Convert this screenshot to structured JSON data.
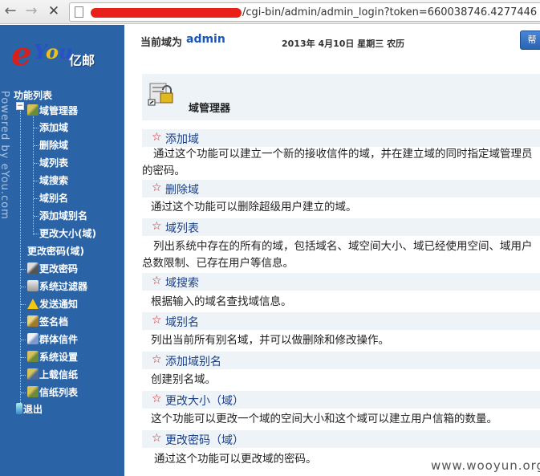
{
  "browser": {
    "url": "/cgi-bin/admin/admin_login?token=660038746.4277446"
  },
  "sidebar": {
    "powered_by": "Powered by eYou.com",
    "logo": {
      "brand": "eYou",
      "brand_cn": "亿邮"
    },
    "menu_title": "功能列表",
    "items": [
      {
        "label": "域管理器",
        "icon": "domain-manager-icon"
      },
      {
        "label": "添加域"
      },
      {
        "label": "删除域"
      },
      {
        "label": "域列表"
      },
      {
        "label": "域搜索"
      },
      {
        "label": "域别名"
      },
      {
        "label": "添加域别名"
      },
      {
        "label": "更改大小(域)"
      },
      {
        "label": "更改密码(域)"
      },
      {
        "label": "更改密码",
        "icon": "key-icon"
      },
      {
        "label": "系统过滤器",
        "icon": "filter-icon"
      },
      {
        "label": "发送通知",
        "icon": "warning-icon"
      },
      {
        "label": "签名档",
        "icon": "signature-icon"
      },
      {
        "label": "群体信件",
        "icon": "group-mail-icon"
      },
      {
        "label": "系统设置",
        "icon": "settings-icon"
      },
      {
        "label": "上载信纸",
        "icon": "upload-icon"
      },
      {
        "label": "信纸列表",
        "icon": "list-icon"
      },
      {
        "label": "退出",
        "icon": "exit-icon"
      }
    ]
  },
  "header": {
    "domain_label": "当前域为",
    "domain_value": "admin",
    "date": "2013年 4月10日 星期三 农历",
    "corner_button": "帮"
  },
  "main": {
    "title": "域管理器",
    "sections": [
      {
        "link": "添加域",
        "desc": "通过这个功能可以建立一个新的接收信件的域，并在建立域的同时指定域管理员的密码。"
      },
      {
        "link": "删除域",
        "desc": "通过这个功能可以删除超级用户建立的域。"
      },
      {
        "link": "域列表",
        "desc": "列出系统中存在的所有的域，包括域名、域空间大小、域已经使用空间、域用户总数限制、已存在用户等信息。"
      },
      {
        "link": "域搜索",
        "desc": "根据输入的域名查找域信息。"
      },
      {
        "link": "域别名",
        "desc": "列出当前所有别名域，并可以做删除和修改操作。"
      },
      {
        "link": "添加域别名",
        "desc": "创建别名域。"
      },
      {
        "link": "更改大小（域）",
        "desc": "这个功能可以更改一个域的空间大小和这个域可以建立用户信箱的数量。"
      },
      {
        "link": "更改密码（域）",
        "desc": "通过这个功能可以更改域的密码。"
      }
    ]
  },
  "watermark": "www.wooyun.org",
  "colors": {
    "sidebar_bg": "#2a63a6",
    "link": "#1a3f86",
    "star": "#d01818",
    "section_band": "#eef3f8",
    "domain_value": "#1a56b8"
  }
}
